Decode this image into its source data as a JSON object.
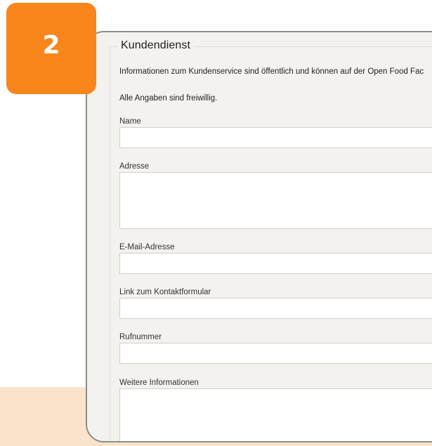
{
  "step_badge": {
    "number": "2",
    "color": "#f8861b"
  },
  "section": {
    "legend": "Kundendienst",
    "info": "Informationen zum Kundenservice sind öffentlich und können auf der Open Food Fac",
    "optional_note": "Alle Angaben sind freiwillig."
  },
  "fields": {
    "name": {
      "label": "Name",
      "value": ""
    },
    "address": {
      "label": "Adresse",
      "value": ""
    },
    "email": {
      "label": "E-Mail-Adresse",
      "value": ""
    },
    "contact_form_link": {
      "label": "Link zum Kontaktformular",
      "value": ""
    },
    "phone": {
      "label": "Rufnummer",
      "value": ""
    },
    "other_info": {
      "label": "Weitere Informationen",
      "value": ""
    }
  },
  "colors": {
    "card_background": "#f3f2ef",
    "card_border": "#8d8d8d",
    "peach_band": "#fbe3cb"
  }
}
